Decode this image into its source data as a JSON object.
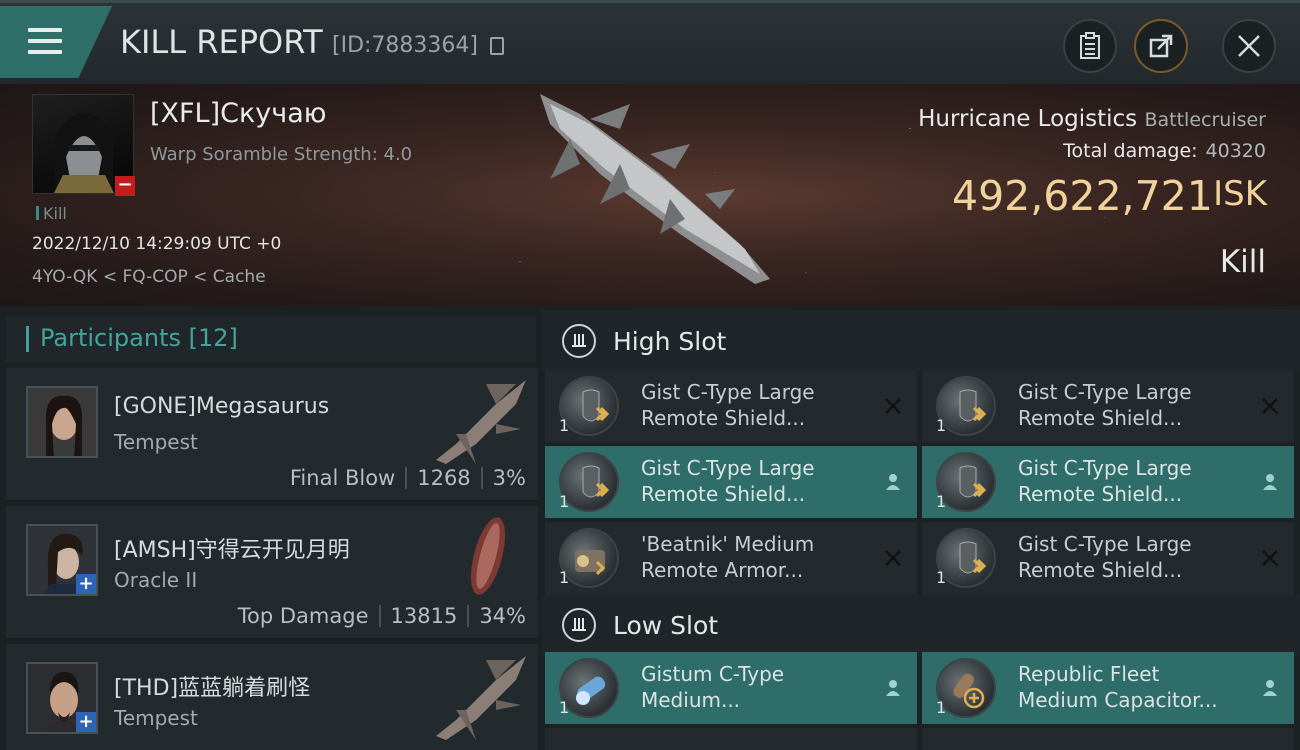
{
  "header": {
    "title": "KILL REPORT",
    "report_id": "[ID:7883364]"
  },
  "victim": {
    "name": "[XFL]Скучаю",
    "subtitle": "Warp Soramble Strength: 4.0",
    "tag": "Kill",
    "datetime": "2022/12/10 14:29:09 UTC +0",
    "location": "4YO-QK < FQ-COP < Cache",
    "ship_name": "Hurricane Logistics",
    "ship_class": "Battlecruiser",
    "total_damage_label": "Total damage:",
    "total_damage": "40320",
    "isk_value": "492,622,721",
    "isk_unit": "ISK",
    "result": "Kill"
  },
  "participants": {
    "label": "Participants",
    "count": "[12]",
    "rows": [
      {
        "name": "[GONE]Megasaurus",
        "ship": "Tempest",
        "role": "Final Blow",
        "damage": "1268",
        "percent": "3%"
      },
      {
        "name": "[AMSH]守得云开见月明",
        "ship": "Oracle II",
        "role": "Top Damage",
        "damage": "13815",
        "percent": "34%"
      },
      {
        "name": "[THD]蓝蓝躺着刷怪",
        "ship": "Tempest",
        "role": "",
        "damage": "",
        "percent": ""
      }
    ]
  },
  "fitting": {
    "high_slot_title": "High Slot",
    "low_slot_title": "Low Slot",
    "high": [
      {
        "qty": "1",
        "line1": "Gist C-Type Large",
        "line2": "Remote Shield...",
        "state": "destroyed"
      },
      {
        "qty": "1",
        "line1": "Gist C-Type Large",
        "line2": "Remote Shield...",
        "state": "destroyed"
      },
      {
        "qty": "1",
        "line1": "Gist C-Type Large",
        "line2": "Remote Shield...",
        "state": "dropped"
      },
      {
        "qty": "1",
        "line1": "Gist C-Type Large",
        "line2": "Remote Shield...",
        "state": "dropped"
      },
      {
        "qty": "1",
        "line1": "'Beatnik' Medium",
        "line2": "Remote Armor...",
        "state": "destroyed"
      },
      {
        "qty": "1",
        "line1": "Gist C-Type Large",
        "line2": "Remote Shield...",
        "state": "destroyed"
      }
    ],
    "low": [
      {
        "qty": "1",
        "line1": "Gistum C-Type",
        "line2": "Medium...",
        "state": "dropped"
      },
      {
        "qty": "1",
        "line1": "Republic Fleet",
        "line2": "Medium Capacitor...",
        "state": "dropped"
      }
    ]
  },
  "colors": {
    "accent_teal": "#2e6d69",
    "isk_gold": "#f1d29a",
    "badge_red": "#c41c1c",
    "badge_blue": "#2e63b5"
  }
}
